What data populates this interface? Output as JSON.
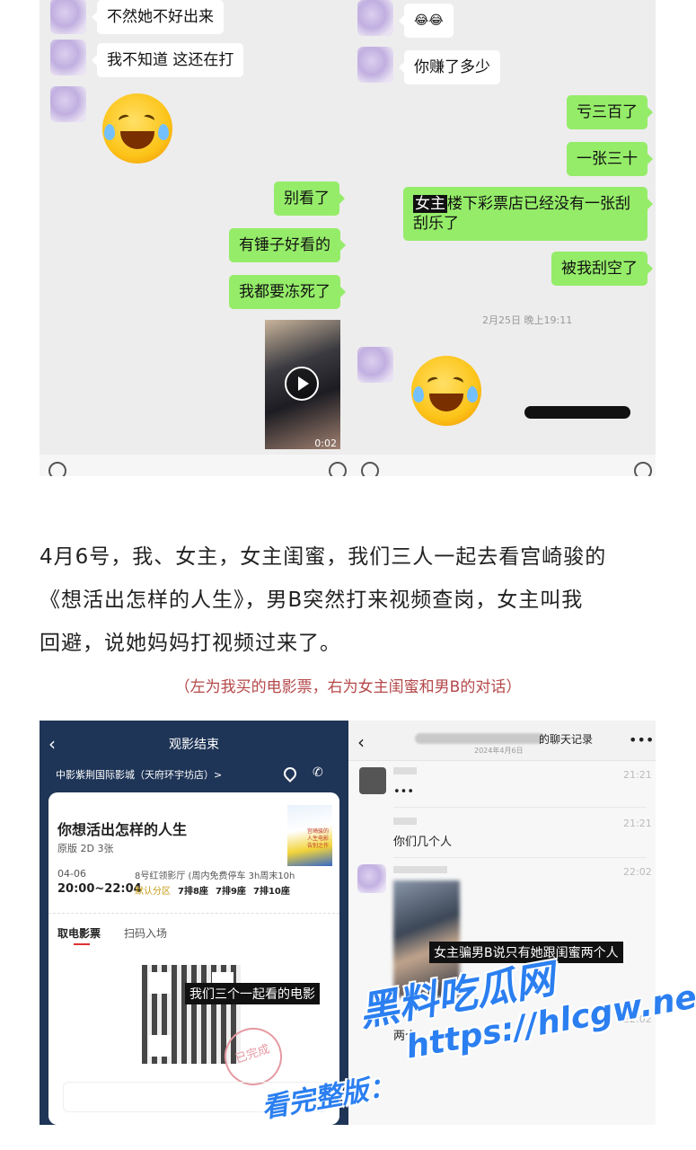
{
  "chat_left": {
    "messages": [
      {
        "side": "left",
        "text": "不然她不好出来"
      },
      {
        "side": "left",
        "text": "我不知道 这还在打"
      },
      {
        "side": "right",
        "text": "别看了"
      },
      {
        "side": "right",
        "text": "有锤子好看的"
      },
      {
        "side": "right",
        "text": "我都要冻死了"
      }
    ],
    "video_duration": "0:02"
  },
  "chat_right": {
    "emoji_text": "😂😂",
    "messages": [
      {
        "side": "left",
        "text": "你赚了多少"
      },
      {
        "side": "right",
        "text": "亏三百了"
      },
      {
        "side": "right",
        "text": "一张三十"
      },
      {
        "side": "right",
        "highlight": "女主",
        "text": "楼下彩票店已经没有一张刮刮乐了"
      },
      {
        "side": "right",
        "text": "被我刮空了"
      }
    ],
    "timestamp": "2月25日 晚上19:11"
  },
  "article": {
    "line1": "4月6号，我、女主，女主闺蜜，我们三人一起去看宫崎骏的",
    "line2": "《想活出怎样的人生》，男B突然打来视频查岗，女主叫我",
    "line3": "回避，说她妈妈打视频过来了。",
    "caption": "（左为我买的电影票，右为女主闺蜜和男B的对话）"
  },
  "ticket": {
    "header_title": "观影结束",
    "cinema": "中影紫荆国际影城（天府环宇坊店）>",
    "movie_title": "你想活出怎样的人生",
    "format": "原版 2D 3张",
    "date": "04-06",
    "time": "20:00~22:04",
    "hall": "8号红领影厅 (周内免费停车 3h周末10h",
    "seat_zone": "默认分区",
    "seats": [
      "7排8座",
      "7排9座",
      "7排10座"
    ],
    "tabs": [
      "取电影票",
      "扫码入场"
    ],
    "overlay": "我们三个一起看的电影",
    "stamp": "已完成",
    "poster_text": "宫崎骏的人生电影告别之作"
  },
  "history": {
    "title": "的聊天记录",
    "date": "2024年4月6日",
    "rows": [
      {
        "time": "21:21",
        "text": "•••"
      },
      {
        "time": "21:21",
        "text": "你们几个人"
      },
      {
        "time": "22:02",
        "text": ""
      },
      {
        "time": "22:02",
        "text": "两个"
      }
    ],
    "overlay": "女主骗男B说只有她跟闺蜜两个人"
  },
  "watermark": {
    "brand": "黑料吃瓜网",
    "url": "https://hlcgw.net",
    "tagline": "看完整版："
  },
  "colors": {
    "sent_bubble": "#95ec69",
    "ticket_bg": "#1f3557",
    "caption": "#b5484a",
    "watermark": "#2b7ff0"
  }
}
